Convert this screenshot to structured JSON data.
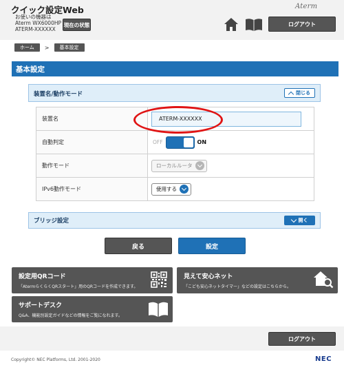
{
  "header": {
    "app_title": "クイック設定Web",
    "device_line1": "お使いの機器は",
    "device_line2": "Aterm WX6000HP",
    "device_line3": "ATERM-XXXXXX",
    "status_button": "現在の状態",
    "brand": "Aterm",
    "logout": "ログアウト"
  },
  "breadcrumb": {
    "home": "ホーム",
    "separator": ">",
    "current": "基本設定"
  },
  "section_title": "基本設定",
  "panel_mode": {
    "title": "装置名/動作モード",
    "toggle_label": "閉じる"
  },
  "settings": {
    "device_name_label": "装置名",
    "device_name_value": "ATERM-XXXXXX",
    "auto_detect_label": "自動判定",
    "auto_detect_off": "OFF",
    "auto_detect_on": "ON",
    "operation_mode_label": "動作モード",
    "operation_mode_value": "ローカルルータ",
    "ipv6_label": "IPv6動作モード",
    "ipv6_value": "使用する"
  },
  "panel_bridge": {
    "title": "ブリッジ設定",
    "toggle_label": "開く"
  },
  "actions": {
    "back": "戻る",
    "apply": "設定"
  },
  "tiles": {
    "qr_title": "設定用QRコード",
    "qr_desc": "「AtermらくらくQRスタート」用のQRコードを作成できます。",
    "net_title": "見えて安心ネット",
    "net_desc": "「こども安心ネットタイマー」などの設定はこちらから。",
    "support_title": "サポートデスク",
    "support_desc": "Q&A、機能別設定ガイドなどの情報をご覧になれます。"
  },
  "footer": {
    "logout": "ログアウト",
    "copyright": "Copyright© NEC Platforms, Ltd. 2001-2020",
    "maker": "NEC"
  },
  "colors": {
    "primary_blue": "#1f71b6",
    "dark_button": "#555555",
    "highlight_red": "#e01414"
  }
}
